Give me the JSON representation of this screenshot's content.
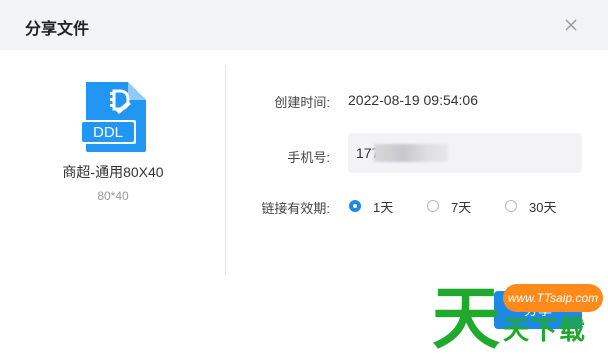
{
  "dialog": {
    "title": "分享文件",
    "close_icon": "close-icon"
  },
  "file": {
    "icon": "ddl-file-icon",
    "icon_text": "DDL",
    "name": "商超-通用80X40",
    "size": "80*40"
  },
  "form": {
    "created_label": "创建时间:",
    "created_value": "2022-08-19 09:54:06",
    "phone_label": "手机号:",
    "phone_value": "177",
    "period_label": "链接有效期:",
    "period_options": [
      {
        "label": "1天",
        "checked": true
      },
      {
        "label": "7天",
        "checked": false
      },
      {
        "label": "30天",
        "checked": false
      }
    ]
  },
  "actions": {
    "share_label": "分享"
  },
  "watermark": {
    "badge": "www.TTsaip.com",
    "big_char": "天",
    "chars": "天下载"
  },
  "colors": {
    "accent": "#1e88e5",
    "header_bg": "#f2f3f5",
    "input_bg": "#f3f3f5",
    "watermark_orange": "#ff8a1a",
    "watermark_green": "#1faa2e"
  }
}
